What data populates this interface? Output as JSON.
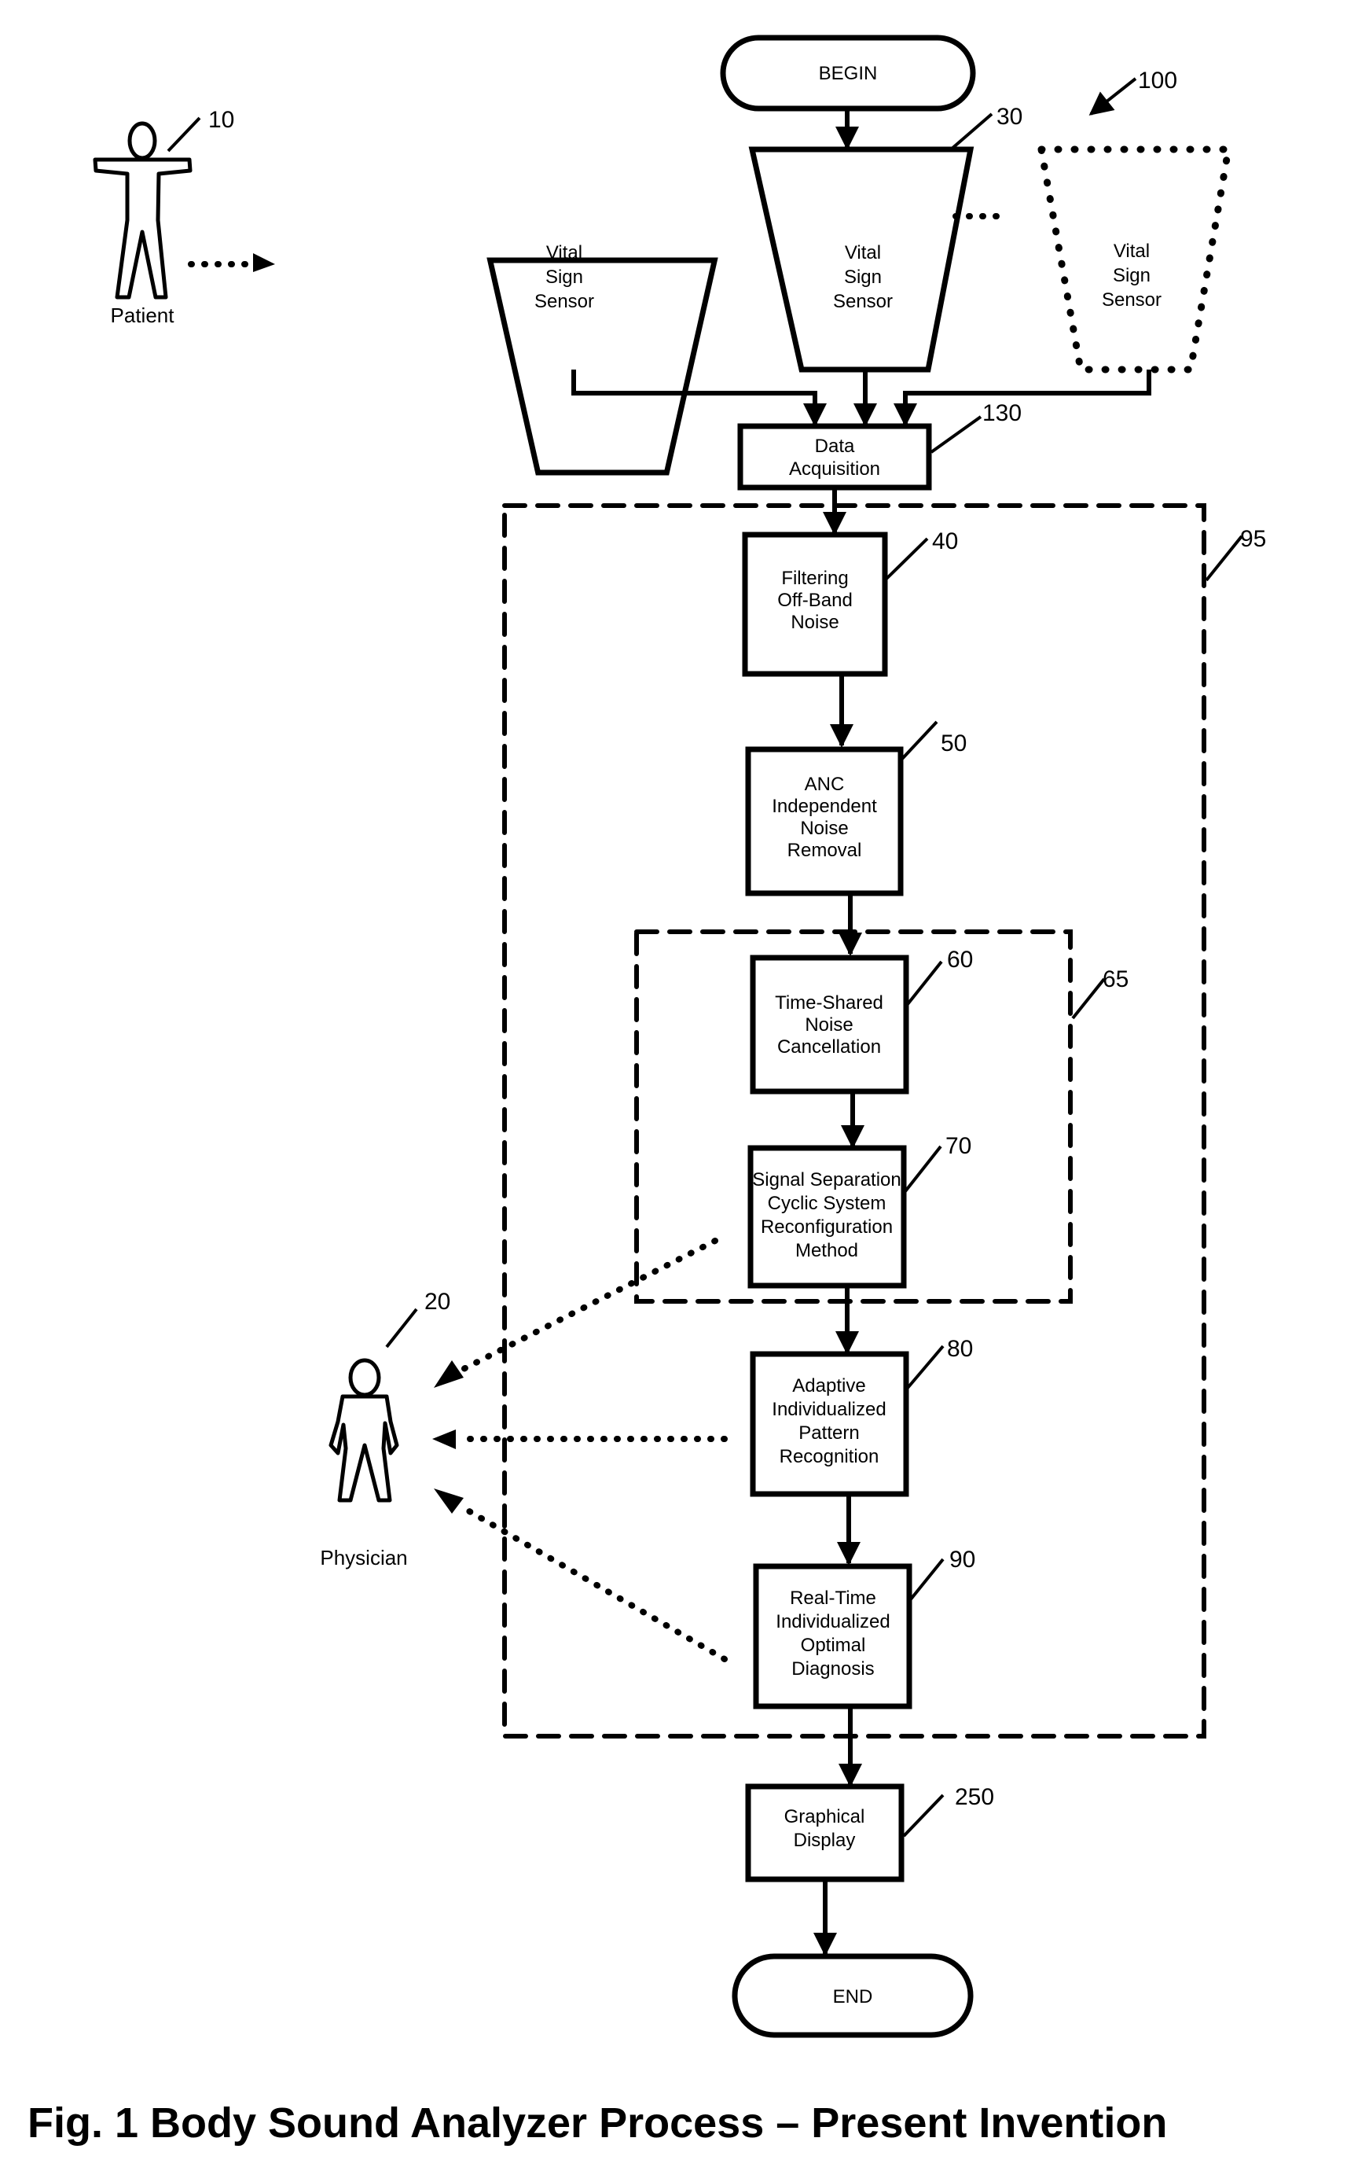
{
  "diagram": {
    "ref_number": "100",
    "caption": "Fig. 1  Body Sound Analyzer Process – Present Invention",
    "begin": "BEGIN",
    "end": "END",
    "actors": {
      "patient": {
        "label": "Patient",
        "ref": "10"
      },
      "physician": {
        "label": "Physician",
        "ref": "20"
      }
    },
    "sensors": [
      {
        "lines": [
          "Vital",
          "Sign",
          "Sensor"
        ],
        "style": "solid"
      },
      {
        "lines": [
          "Vital",
          "Sign",
          "Sensor"
        ],
        "style": "solid",
        "ref": "30"
      },
      {
        "lines": [
          "Vital",
          "Sign",
          "Sensor"
        ],
        "style": "dotted"
      }
    ],
    "steps": {
      "data_acquisition": {
        "lines": [
          "Data",
          "Acquisition"
        ],
        "ref": "130"
      },
      "filtering": {
        "lines": [
          "Filtering",
          "Off-Band",
          "Noise"
        ],
        "ref": "40"
      },
      "anc": {
        "lines": [
          "ANC",
          "Independent",
          "Noise",
          "Removal"
        ],
        "ref": "50"
      },
      "time_shared": {
        "lines": [
          "Time-Shared",
          "Noise",
          "Cancellation"
        ],
        "ref": "60"
      },
      "signal_separation": {
        "lines": [
          "Signal Separation",
          "Cyclic System",
          "Reconfiguration",
          "Method"
        ],
        "ref": "70"
      },
      "pattern_recognition": {
        "lines": [
          "Adaptive",
          "Individualized",
          "Pattern",
          "Recognition"
        ],
        "ref": "80"
      },
      "diagnosis": {
        "lines": [
          "Real-Time",
          "Individualized",
          "Optimal",
          "Diagnosis"
        ],
        "ref": "90"
      },
      "graphical_display": {
        "lines": [
          "Graphical",
          "Display"
        ],
        "ref": "250"
      }
    },
    "groups": {
      "outer": {
        "ref": "95"
      },
      "inner": {
        "ref": "65"
      }
    }
  }
}
